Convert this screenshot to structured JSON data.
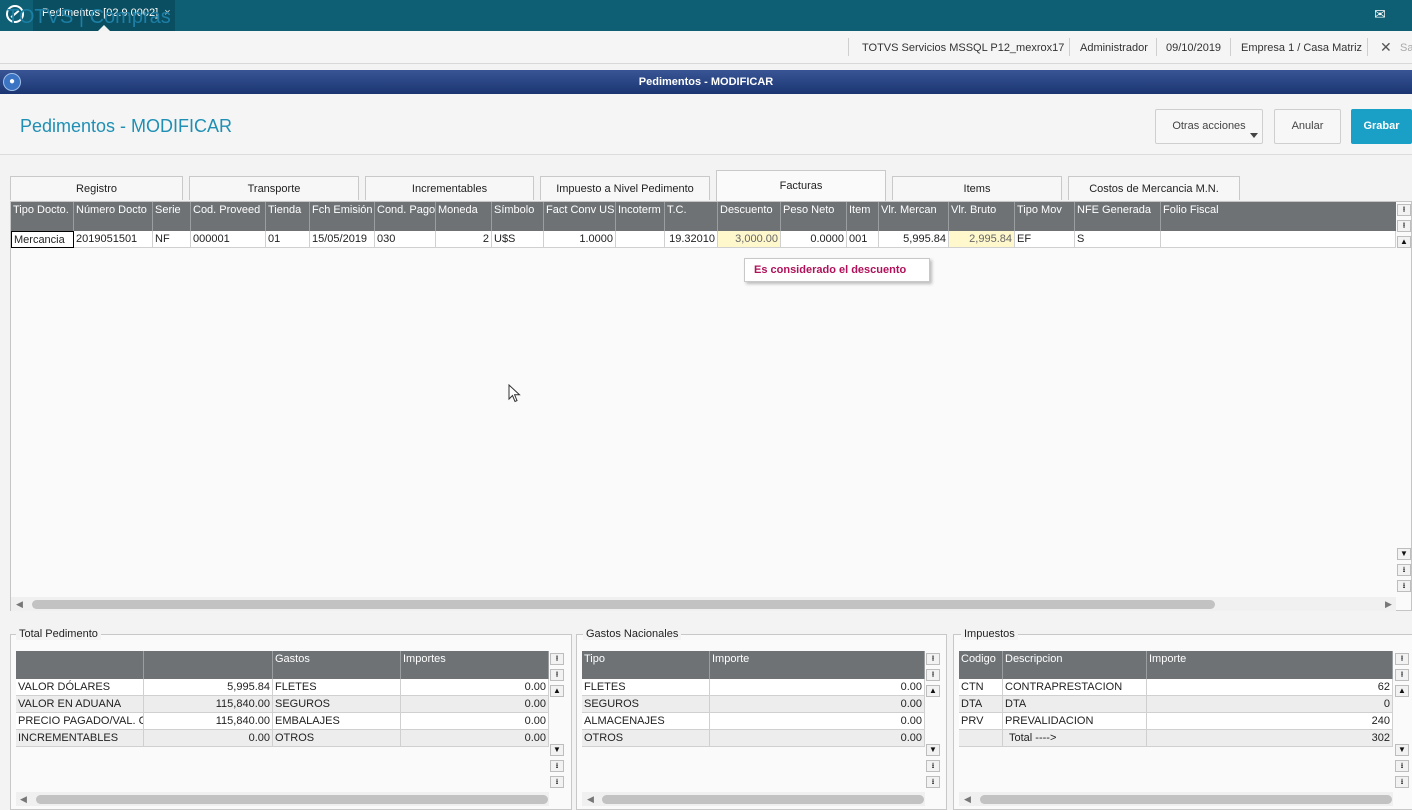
{
  "app": {
    "tab_title": "Pedimentos [02.9.0002]",
    "tab_close": "×",
    "brand": "TOTVS | Compras",
    "env": "TOTVS Servicios MSSQL P12_mexrox17",
    "user": "Administrador",
    "date": "09/10/2019",
    "company": "Empresa 1 / Casa Matriz",
    "close": "✕",
    "sa": "Sa"
  },
  "window": {
    "title": "Pedimentos - MODIFICAR",
    "page_title": "Pedimentos - MODIFICAR"
  },
  "actions": {
    "otras": "Otras acciones",
    "anular": "Anular",
    "grabar": "Grabar"
  },
  "tabs": [
    "Registro",
    "Transporte",
    "Incrementables",
    "Impuesto a Nivel Pedimento",
    "Facturas",
    "Items",
    "Costos de Mercancia M.N."
  ],
  "grid": {
    "headers": [
      "Tipo Docto.",
      "Número Docto",
      "Serie",
      "Cod. Proveed",
      "Tienda",
      "Fch Emisión",
      "Cond. Pago",
      "Moneda",
      "Símbolo",
      "Fact Conv US",
      "Incoterm",
      "T.C.",
      "Descuento",
      "Peso Neto",
      "Item",
      "Vlr. Mercan",
      "Vlr. Bruto",
      "Tipo Mov",
      "NFE Generada",
      "Folio Fiscal"
    ],
    "row": [
      "Mercancia",
      "2019051501",
      "NF",
      "000001",
      "01",
      "15/05/2019",
      "030",
      "2",
      "U$S",
      "1.0000",
      "",
      "19.32010",
      "3,000.00",
      "0.0000",
      "001",
      "5,995.84",
      "2,995.84",
      "EF",
      "S",
      ""
    ]
  },
  "tooltip": "Es considerado el descuento",
  "total_pedimento": {
    "legend": "Total Pedimento",
    "headers": [
      "",
      "",
      "Gastos",
      "Importes"
    ],
    "rows": [
      [
        "VALOR DÓLARES",
        "5,995.84",
        "FLETES",
        "0.00"
      ],
      [
        "VALOR EN ADUANA",
        "115,840.00",
        "SEGUROS",
        "0.00"
      ],
      [
        "PRECIO PAGADO/VAL. C(",
        "115,840.00",
        "EMBALAJES",
        "0.00"
      ],
      [
        "INCREMENTABLES",
        "0.00",
        "OTROS",
        "0.00"
      ]
    ]
  },
  "gastos_nacionales": {
    "legend": "Gastos Nacionales",
    "headers": [
      "Tipo",
      "Importe"
    ],
    "rows": [
      [
        "FLETES",
        "0.00"
      ],
      [
        "SEGUROS",
        "0.00"
      ],
      [
        "ALMACENAJES",
        "0.00"
      ],
      [
        "OTROS",
        "0.00"
      ]
    ]
  },
  "impuestos": {
    "legend": "Impuestos",
    "headers": [
      "Codigo",
      "Descripcion",
      "Importe"
    ],
    "rows": [
      [
        "CTN",
        "CONTRAPRESTACION",
        "62"
      ],
      [
        "DTA",
        "DTA",
        "0"
      ],
      [
        "PRV",
        "PREVALIDACION",
        "240"
      ],
      [
        "",
        "Total ---->",
        "302"
      ]
    ]
  },
  "scroll": {
    "up_top": "⭱",
    "up_page": "⭱",
    "up": "▲",
    "down": "▼",
    "down_page": "⭳",
    "down_bottom": "⭳",
    "left": "◀",
    "right": "▶"
  }
}
